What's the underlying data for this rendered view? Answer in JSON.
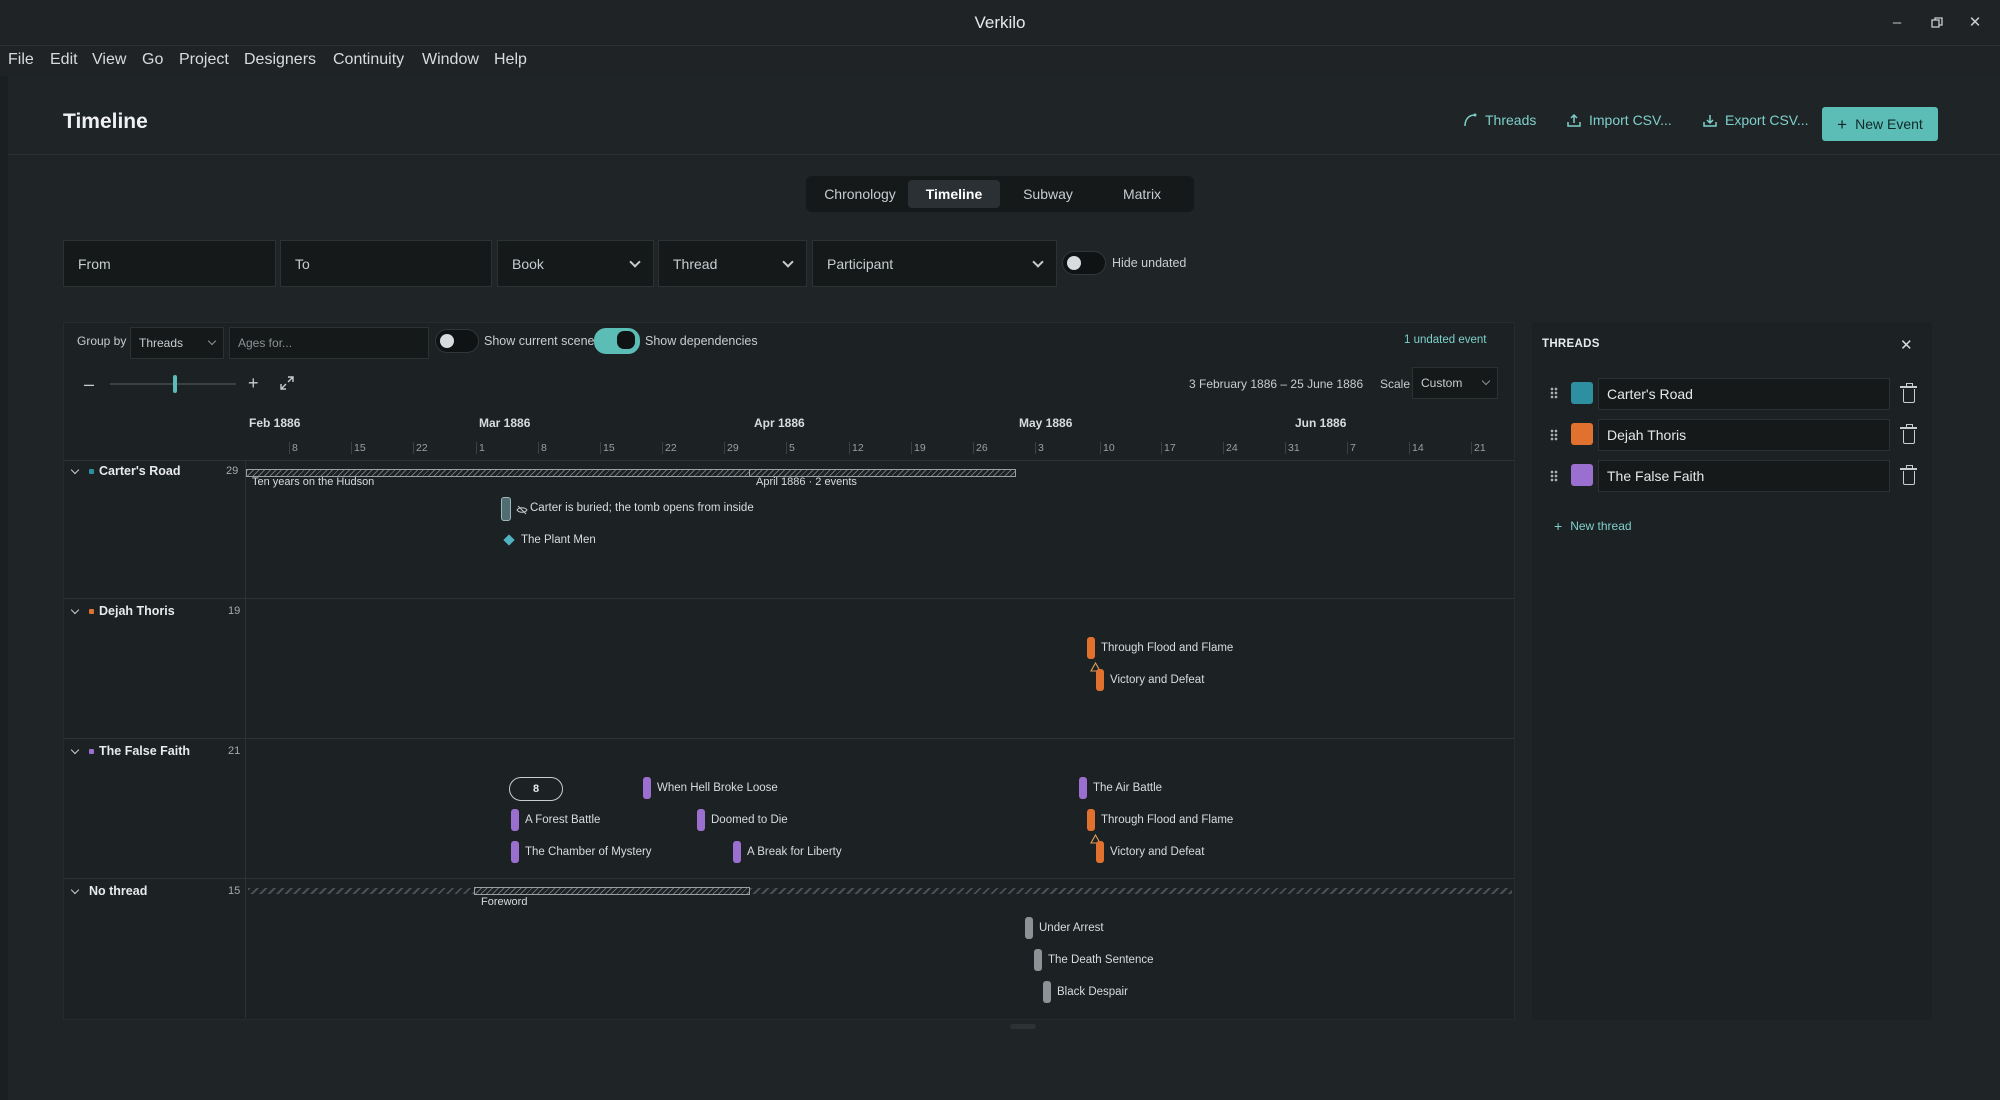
{
  "window": {
    "title": "Verkilo"
  },
  "menu": [
    "File",
    "Edit",
    "View",
    "Go",
    "Project",
    "Designers",
    "Continuity",
    "Window",
    "Help"
  ],
  "header": {
    "title": "Timeline",
    "threads_btn": "Threads",
    "import_btn": "Import CSV...",
    "export_btn": "Export CSV...",
    "new_event_btn": "New Event"
  },
  "view_tabs": {
    "items": [
      "Chronology",
      "Timeline",
      "Subway",
      "Matrix"
    ],
    "active": "Timeline"
  },
  "filters": {
    "from_placeholder": "From",
    "to_placeholder": "To",
    "book": "Book",
    "thread": "Thread",
    "participant": "Participant",
    "hide_undated": "Hide undated",
    "hide_undated_on": false
  },
  "controls": {
    "group_by_label": "Group by",
    "group_by_value": "Threads",
    "ages_placeholder": "Ages for...",
    "show_current_scene": "Show current scene",
    "show_current_scene_on": false,
    "show_dependencies": "Show dependencies",
    "show_dependencies_on": true,
    "undated_link": "1 undated event",
    "date_range": "3 February 1886 – 25 June 1886",
    "scale_label": "Scale",
    "scale_value": "Custom",
    "zoom_level": 0.52
  },
  "axis": {
    "months": [
      "Feb 1886",
      "Mar 1886",
      "Apr 1886",
      "May 1886",
      "Jun 1886"
    ],
    "days": [
      "8",
      "15",
      "22",
      "1",
      "8",
      "15",
      "22",
      "29",
      "5",
      "12",
      "19",
      "26",
      "3",
      "10",
      "17",
      "24",
      "31",
      "7",
      "14",
      "21"
    ]
  },
  "groups": [
    {
      "name": "Carter's Road",
      "count": "29",
      "color": "#2e8fa0",
      "span_label": "Ten years on the Hudson",
      "cluster_label": "April 1886 · 2 events",
      "events": [
        {
          "label": "Carter is buried; the tomb opens from inside",
          "kind": "hidden"
        },
        {
          "label": "The Plant Men",
          "kind": "diamond"
        }
      ]
    },
    {
      "name": "Dejah Thoris",
      "count": "19",
      "color": "#e0712f",
      "events": [
        {
          "label": "Through Flood and Flame"
        },
        {
          "label": "Victory and Defeat"
        }
      ]
    },
    {
      "name": "The False Faith",
      "count": "21",
      "color": "#9a6fd0",
      "cluster_count": "8",
      "events": [
        {
          "label": "When Hell Broke Loose"
        },
        {
          "label": "A Forest Battle"
        },
        {
          "label": "Doomed to Die"
        },
        {
          "label": "The Chamber of Mystery"
        },
        {
          "label": "A Break for Liberty"
        },
        {
          "label": "The Air Battle"
        },
        {
          "label": "Through Flood and Flame"
        },
        {
          "label": "Victory and Defeat"
        }
      ]
    },
    {
      "name": "No thread",
      "count": "15",
      "color": "#9aa0a3",
      "span_label": "Foreword",
      "events": [
        {
          "label": "Under Arrest"
        },
        {
          "label": "The Death Sentence"
        },
        {
          "label": "Black Despair"
        }
      ]
    }
  ],
  "threads_panel": {
    "title": "THREADS",
    "threads": [
      {
        "name": "Carter's Road",
        "color": "#2e8fa0"
      },
      {
        "name": "Dejah Thoris",
        "color": "#e0712f"
      },
      {
        "name": "The False Faith",
        "color": "#9a6fd0"
      }
    ],
    "new_thread": "New thread"
  }
}
